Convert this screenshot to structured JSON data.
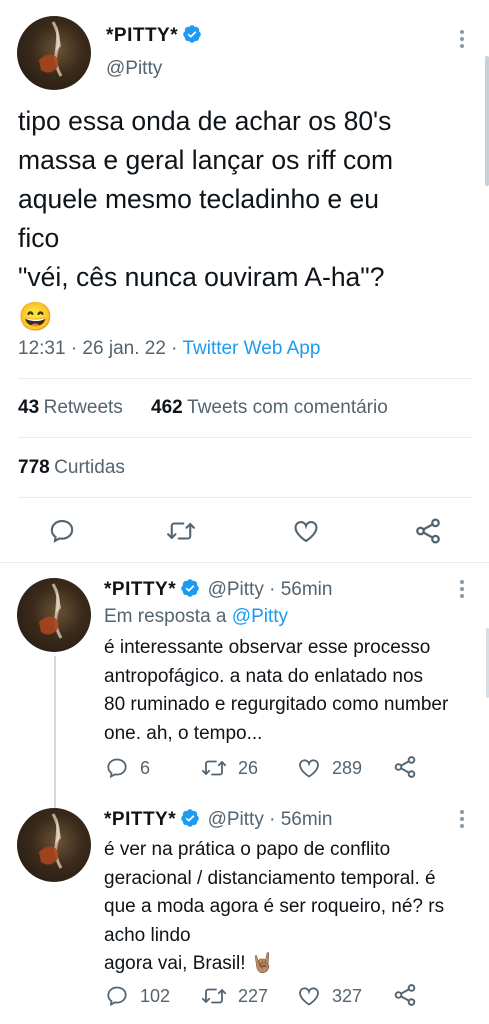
{
  "main_tweet": {
    "display_name": "*PITTY*",
    "handle": "@Pitty",
    "text_lines": [
      "tipo essa onda de achar os 80's",
      "massa e geral lançar os riff com",
      "aquele mesmo tecladinho e eu",
      "fico",
      "\"véi, cês nunca ouviram A-ha\"?"
    ],
    "emoji": "😄",
    "time": "12:31 · 26 jan. 22 · ",
    "source": "Twitter Web App",
    "retweets_count": "43",
    "retweets_label": "Retweets",
    "quotes_count": "462",
    "quotes_label": "Tweets com comentário",
    "likes_count": "778",
    "likes_label": "Curtidas"
  },
  "replies": [
    {
      "display_name": "*PITTY*",
      "handle_time": "@Pitty · 56min",
      "reply_prefix": "Em resposta a ",
      "reply_to": "@Pitty",
      "lines": [
        "é interessante observar esse processo",
        "antropofágico. a nata do enlatado nos",
        "80 ruminado e regurgitado como number",
        "one. ah, o tempo..."
      ],
      "reply_count": "6",
      "retweet_count": "26",
      "like_count": "289"
    },
    {
      "display_name": "*PITTY*",
      "handle_time": "@Pitty · 56min",
      "lines": [
        "é ver na prática o papo de conflito",
        "geracional / distanciamento temporal. é",
        "que a moda agora é ser roqueiro, né? rs",
        "acho lindo",
        "agora vai, Brasil! 🤘🏽"
      ],
      "reply_count": "102",
      "retweet_count": "227",
      "like_count": "327"
    }
  ],
  "colors": {
    "accent": "#1d9bf0",
    "text": "#0f1419",
    "secondary": "#536471",
    "divider": "#e6ecf0"
  }
}
